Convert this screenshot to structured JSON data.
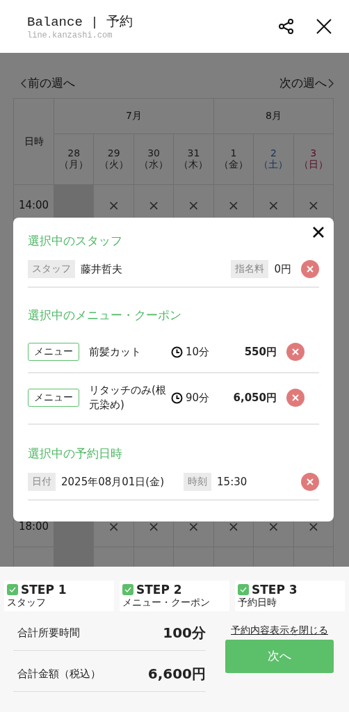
{
  "header": {
    "title": "Balance | 予約",
    "url": "line.kanzashi.com"
  },
  "calendar": {
    "prev": "前の週へ",
    "next": "次の週へ",
    "corner": "日時",
    "months": [
      {
        "label": "7月",
        "days": [
          {
            "date": "28",
            "weekday": "（月）",
            "kind": "weekday"
          },
          {
            "date": "29",
            "weekday": "（火）",
            "kind": "weekday"
          },
          {
            "date": "30",
            "weekday": "（水）",
            "kind": "weekday"
          },
          {
            "date": "31",
            "weekday": "（木）",
            "kind": "weekday"
          }
        ]
      },
      {
        "label": "8月",
        "days": [
          {
            "date": "1",
            "weekday": "（金）",
            "kind": "weekday"
          },
          {
            "date": "2",
            "weekday": "（土）",
            "kind": "saturday"
          },
          {
            "date": "3",
            "weekday": "（日）",
            "kind": "sunday"
          }
        ]
      }
    ],
    "rows": [
      {
        "time": "14:00",
        "cells": [
          {
            "kind": "closed"
          },
          {
            "kind": "slot",
            "mark": "×"
          },
          {
            "kind": "slot",
            "mark": "×"
          },
          {
            "kind": "slot",
            "mark": "×"
          },
          {
            "kind": "slot",
            "mark": "×"
          },
          {
            "kind": "slot",
            "mark": "×"
          },
          {
            "kind": "slot",
            "mark": "×"
          }
        ]
      },
      {
        "time": "18:00",
        "cells": [
          {
            "kind": "closed"
          },
          {
            "kind": "slot",
            "mark": "×"
          },
          {
            "kind": "slot",
            "mark": "×"
          },
          {
            "kind": "slot",
            "mark": "×"
          },
          {
            "kind": "slot",
            "mark": "×"
          },
          {
            "kind": "slot",
            "mark": "×"
          },
          {
            "kind": "slot",
            "mark": "×"
          }
        ]
      }
    ]
  },
  "modal": {
    "staff": {
      "heading": "選択中のスタッフ",
      "tag": "スタッフ",
      "name": "藤井哲夫",
      "fee_tag": "指名料",
      "fee": "0円"
    },
    "menu": {
      "heading": "選択中のメニュー・クーポン",
      "items": [
        {
          "tag": "メニュー",
          "name": "前髪カット",
          "duration": "10分",
          "price": "550円"
        },
        {
          "tag": "メニュー",
          "name": "リタッチのみ(根元染め)",
          "duration": "90分",
          "price": "6,050円"
        }
      ]
    },
    "datetime": {
      "heading": "選択中の予約日時",
      "date_tag": "日付",
      "date": "2025年08月01日(金)",
      "time_tag": "時刻",
      "time": "15:30"
    }
  },
  "footer": {
    "steps": [
      {
        "step": "STEP 1",
        "label": "スタッフ",
        "done": true
      },
      {
        "step": "STEP 2",
        "label": "メニュー・クーポン",
        "done": true
      },
      {
        "step": "STEP 3",
        "label": "予約日時",
        "done": true
      }
    ],
    "totals": [
      {
        "label": "合計所要時間",
        "value": "100分"
      },
      {
        "label": "合計金額（税込）",
        "value": "6,600円"
      }
    ],
    "link": "予約内容表示を閉じる",
    "button": "次へ"
  }
}
